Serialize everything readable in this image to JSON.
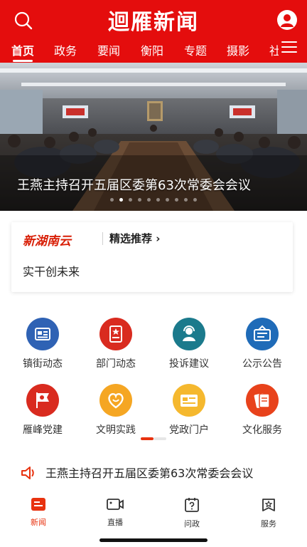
{
  "header": {
    "app_title": "迴雁新闻",
    "brand_color": "#e40d0d",
    "search_icon": "search-icon",
    "user_icon": "user-icon",
    "menu_icon": "menu-icon"
  },
  "nav_tabs": [
    {
      "label": "首页",
      "active": true
    },
    {
      "label": "政务",
      "active": false
    },
    {
      "label": "要闻",
      "active": false
    },
    {
      "label": "衡阳",
      "active": false
    },
    {
      "label": "专题",
      "active": false
    },
    {
      "label": "摄影",
      "active": false
    },
    {
      "label": "社",
      "active": false
    }
  ],
  "banner": {
    "caption": "王燕主持召开五届区委第63次常委会会议",
    "slide_count": 10,
    "active_slide": 2
  },
  "promo": {
    "logo_text": "新湖南云",
    "link_label": "精选推荐",
    "subtitle": "实干创未来"
  },
  "grid": [
    {
      "label": "镇街动态",
      "icon": "news-card-icon",
      "color": "#2f62b4"
    },
    {
      "label": "部门动态",
      "icon": "document-icon",
      "color": "#d92b1f"
    },
    {
      "label": "投诉建议",
      "icon": "service-agent-icon",
      "color": "#1b7a8c"
    },
    {
      "label": "公示公告",
      "icon": "notice-board-icon",
      "color": "#1f6bb8"
    },
    {
      "label": "雁峰党建",
      "icon": "party-flag-icon",
      "color": "#d92b1f"
    },
    {
      "label": "文明实践",
      "icon": "heart-icon",
      "color": "#f5a623"
    },
    {
      "label": "党政门户",
      "icon": "id-card-icon",
      "color": "#f5b82e"
    },
    {
      "label": "文化服务",
      "icon": "cards-icon",
      "color": "#e8421b"
    }
  ],
  "grid_page": {
    "pages": 2,
    "active": 1
  },
  "ticker": {
    "icon": "speaker-icon",
    "text": "王燕主持召开五届区委第63次常委会会议"
  },
  "bottom_nav": [
    {
      "label": "新闻",
      "icon": "news-tab-icon",
      "active": true
    },
    {
      "label": "直播",
      "icon": "video-camera-icon",
      "active": false
    },
    {
      "label": "问政",
      "icon": "question-icon",
      "active": false
    },
    {
      "label": "服务",
      "icon": "service-star-icon",
      "active": false
    }
  ],
  "accent_color": "#e8320f"
}
